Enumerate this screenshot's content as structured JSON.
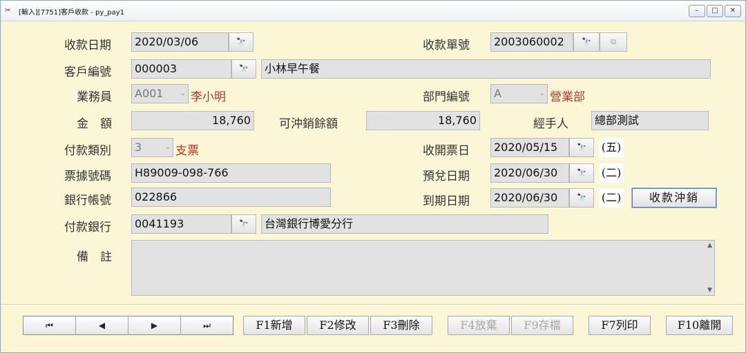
{
  "window": {
    "title": "[輸入][7751]客戶收款 - py_pay1",
    "minimize_icon": "minimize-icon",
    "maximize_icon": "maximize-icon",
    "close_icon": "close-icon"
  },
  "form": {
    "receipt_date": {
      "label": "收款日期",
      "value": "2020/03/06"
    },
    "receipt_no": {
      "label": "收款單號",
      "value": "2003060002"
    },
    "customer_no": {
      "label": "客戶編號",
      "value": "000003",
      "name": "小林早午餐"
    },
    "salesperson": {
      "label": "業務員",
      "value": "A001",
      "name": "李小明"
    },
    "dept_no": {
      "label": "部門編號",
      "value": "A",
      "name": "營業部"
    },
    "amount": {
      "label": "金　額",
      "value": "18,760"
    },
    "offset_balance": {
      "label": "可沖銷餘額",
      "value": "18,760"
    },
    "handler": {
      "label": "經手人",
      "value": "總部測試"
    },
    "payment_type": {
      "label": "付款類別",
      "value": "3",
      "name": "支票"
    },
    "issue_date": {
      "label": "收開票日",
      "value": "2020/05/15",
      "weekday": "(五)"
    },
    "cheque_no": {
      "label": "票據號碼",
      "value": "H89009-098-766"
    },
    "expected_date": {
      "label": "預兌日期",
      "value": "2020/06/30",
      "weekday": "(二)"
    },
    "bank_account": {
      "label": "銀行帳號",
      "value": "022866"
    },
    "due_date": {
      "label": "到期日期",
      "value": "2020/06/30",
      "weekday": "(二)"
    },
    "offset_button": "收款沖銷",
    "pay_bank": {
      "label": "付款銀行",
      "value": "0041193",
      "name": "台灣銀行博愛分行"
    },
    "memo": {
      "label": "備　註",
      "value": ""
    }
  },
  "nav": {
    "first": "⏮",
    "prev": "◀",
    "next": "▶",
    "last": "⏭"
  },
  "buttons": {
    "add": "F1新增",
    "edit": "F2修改",
    "delete": "F3刪除",
    "abandon": "F4放棄",
    "save": "F9存檔",
    "print": "F7列印",
    "exit": "F10離開"
  }
}
